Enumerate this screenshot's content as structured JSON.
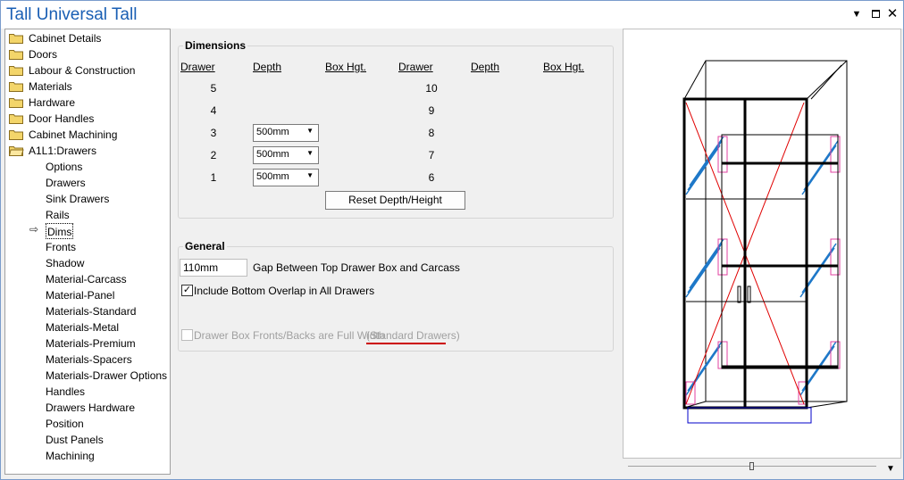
{
  "window": {
    "title": "Tall Universal Tall",
    "menu_icon": "dropdown-arrow-icon",
    "maximize_icon": "maximize-icon",
    "close_icon": "close-icon"
  },
  "tree": {
    "folders": [
      "Cabinet Details",
      "Doors",
      "Labour & Construction",
      "Materials",
      "Hardware",
      "Door Handles",
      "Cabinet Machining",
      "A1L1:Drawers"
    ],
    "children": [
      "Options",
      "Drawers",
      "Sink Drawers",
      "Rails",
      "Dims",
      "Fronts",
      "Shadow",
      "Material-Carcass",
      "Material-Panel",
      "Materials-Standard",
      "Materials-Metal",
      "Materials-Premium",
      "Materials-Spacers",
      "Materials-Drawer Options",
      "Handles",
      "Drawers Hardware",
      "Position",
      "Dust Panels",
      "Machining"
    ],
    "selected": "Dims"
  },
  "dimensions": {
    "title": "Dimensions",
    "headers": [
      "Drawer",
      "Depth",
      "Box Hgt.",
      "Drawer",
      "Depth",
      "Box Hgt."
    ],
    "left_rows": [
      {
        "drawer": "5",
        "depth": ""
      },
      {
        "drawer": "4",
        "depth": ""
      },
      {
        "drawer": "3",
        "depth": "500mm"
      },
      {
        "drawer": "2",
        "depth": "500mm"
      },
      {
        "drawer": "1",
        "depth": "500mm"
      }
    ],
    "right_rows": [
      "10",
      "9",
      "8",
      "7",
      "6"
    ],
    "reset_button": "Reset Depth/Height"
  },
  "general": {
    "title": "General",
    "gap_value": "110mm",
    "gap_label": "Gap Between Top Drawer Box and Carcass",
    "include_bottom_overlap_label": "Include Bottom Overlap in All Drawers",
    "include_bottom_overlap_checked": true,
    "full_width_label": "Drawer Box Fronts/Backs are Full Width",
    "full_width_note": "(Standard Drawers)",
    "full_width_checked": false
  },
  "colors": {
    "title": "#1a5fb4",
    "underline": "#cc0000",
    "preview_blue": "#1e78c8",
    "preview_pink": "#e040a0",
    "preview_red": "#e00000"
  }
}
